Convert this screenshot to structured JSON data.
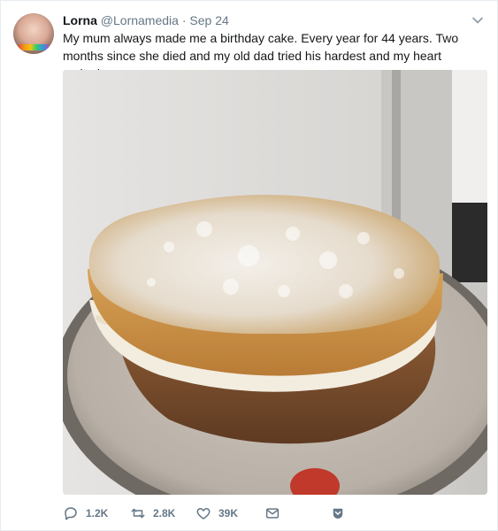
{
  "tweet": {
    "author_name": "Lorna",
    "author_handle": "@Lornamedia",
    "separator": "·",
    "date": "Sep 24",
    "text": "My mum always made me a birthday cake. Every year for 44 years. Two months since she died and my old dad tried his hardest and my heart melted...",
    "photo_subject": "Homemade sponge cake with cream filling dusted with powdered sugar",
    "actions": {
      "reply_count": "1.2K",
      "retweet_count": "2.8K",
      "like_count": "39K"
    }
  },
  "colors": {
    "text": "#14171a",
    "muted": "#657786",
    "border": "#e6ecf0"
  },
  "icons": [
    "chevron-down-icon",
    "reply-icon",
    "retweet-icon",
    "like-icon",
    "message-icon",
    "save-icon"
  ]
}
